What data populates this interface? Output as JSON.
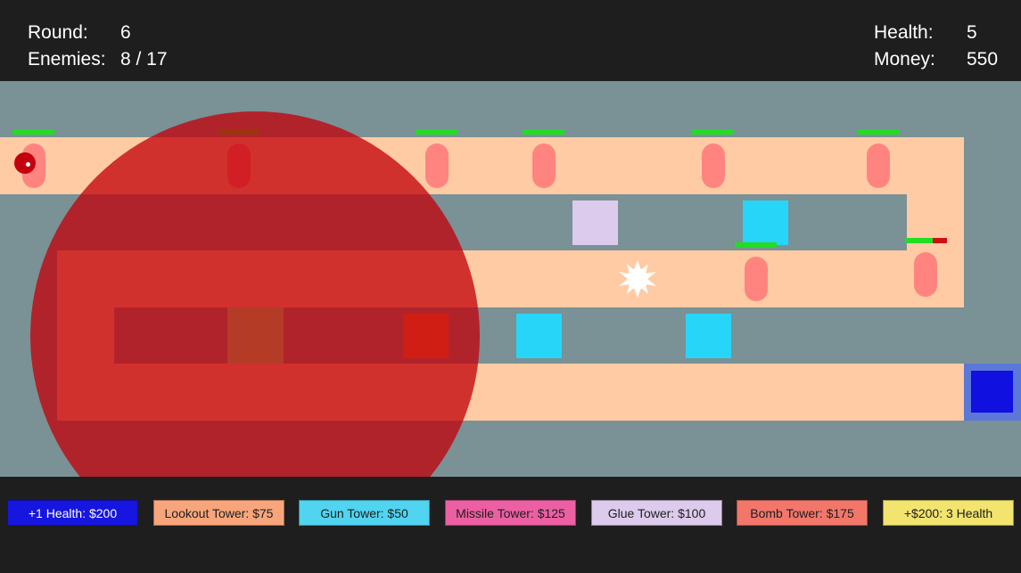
{
  "hud": {
    "round_label": "Round:",
    "round_value": "6",
    "enemies_label": "Enemies:",
    "enemies_value": "8 / 17",
    "health_label": "Health:",
    "health_value": "5",
    "money_label": "Money:",
    "money_value": "550"
  },
  "colors": {
    "background": "#1e1e1e",
    "field": "#7a9196",
    "path": "#ffcba4",
    "range_circle": "#c30008",
    "enemy": "#ff8480",
    "health_bar": "#22dd22",
    "health_bar_lost": "#cc1111",
    "glue_tower": "#dccbec",
    "gun_tower": "#27d5f8",
    "lookout_tower": "#86fa8c",
    "bomb_tower": "#ff7d40",
    "base": "#1010e0"
  },
  "icons": {
    "explosion": "explosion-icon",
    "base": "base-icon"
  },
  "enemies": [
    {
      "health": 1.0
    },
    {
      "health": 1.0
    },
    {
      "health": 1.0
    },
    {
      "health": 1.0
    },
    {
      "health": 1.0
    },
    {
      "health": 1.0
    },
    {
      "health": 1.0
    },
    {
      "health": 0.65
    }
  ],
  "shop": [
    {
      "label": "+1 Health: $200",
      "color": "#1616e0",
      "text_color": "#ffffff"
    },
    {
      "label": "Lookout Tower: $75",
      "color": "#f8a57c",
      "text_color": "#1e1e1e"
    },
    {
      "label": "Gun Tower: $50",
      "color": "#50d4f0",
      "text_color": "#1e1e1e"
    },
    {
      "label": "Missile Tower: $125",
      "color": "#ec5fa3",
      "text_color": "#1e1e1e"
    },
    {
      "label": "Glue Tower: $100",
      "color": "#dccbec",
      "text_color": "#1e1e1e"
    },
    {
      "label": "Bomb Tower: $175",
      "color": "#f2776a",
      "text_color": "#1e1e1e"
    },
    {
      "label": "+$200: 3 Health",
      "color": "#f2e46e",
      "text_color": "#1e1e1e"
    }
  ]
}
